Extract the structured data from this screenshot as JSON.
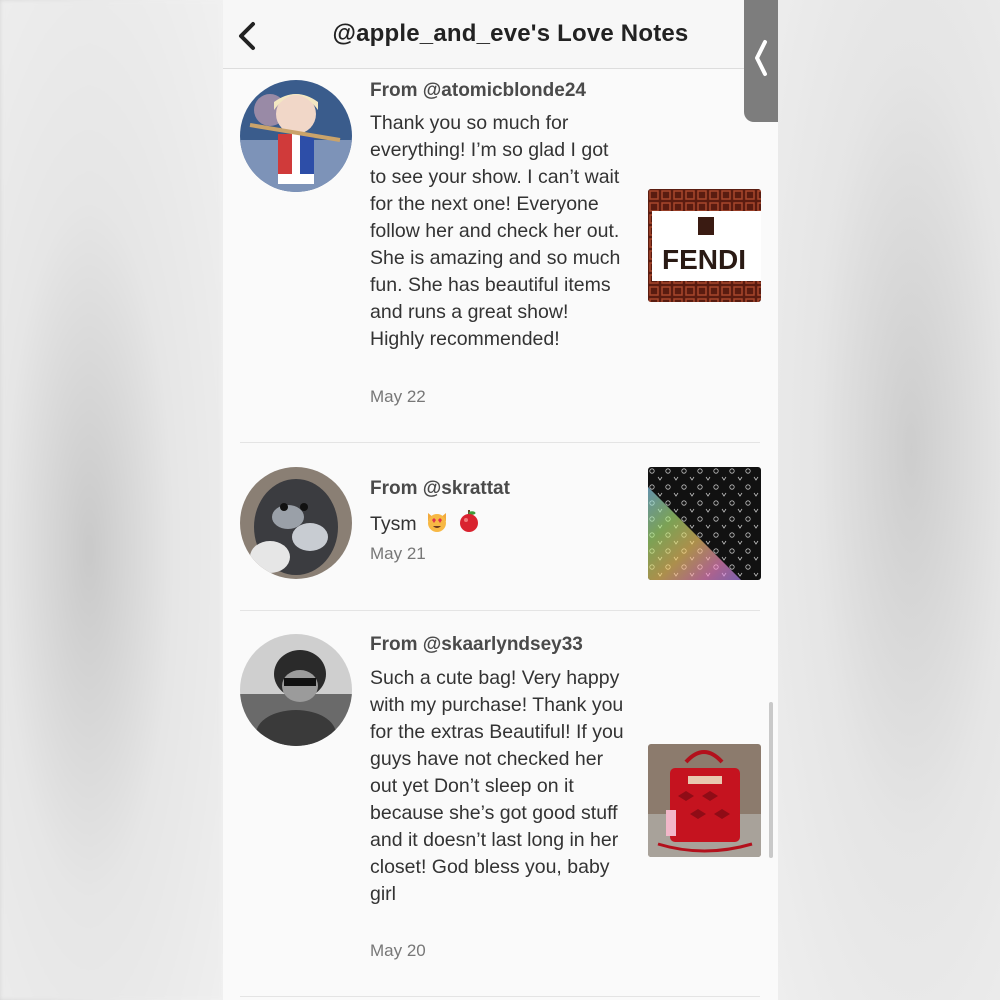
{
  "header": {
    "title": "@apple_and_eve's Love Notes",
    "back_icon": "chevron-left-icon",
    "side_tab_icon": "chevron-left-icon"
  },
  "notes": [
    {
      "from": "From @atomicblonde24",
      "message": "Thank you so much for everything! I’m so glad I got to see your show. I can’t wait for the next one! Everyone follow her and check her out. She is amazing and so much fun. She has beautiful items and runs a great show! Highly recommended!",
      "date": "May 22",
      "thumb_text": "FENDI"
    },
    {
      "from": "From @skrattat",
      "message": "Tysm",
      "emoji_icons": [
        "heart-eyes-cat-icon",
        "apple-icon"
      ],
      "date": "May 21"
    },
    {
      "from": "From @skaarlyndsey33",
      "message": "Such a cute bag! Very happy with my purchase! Thank you for the extras Beautiful! If you guys have not checked her out yet Don’t sleep on it because she’s got good stuff and it doesn’t last long in her closet! God bless you, baby girl",
      "date": "May 20"
    }
  ],
  "colors": {
    "accent_side_tab": "#7d7d7d",
    "text": "#333333",
    "date": "#777777"
  }
}
